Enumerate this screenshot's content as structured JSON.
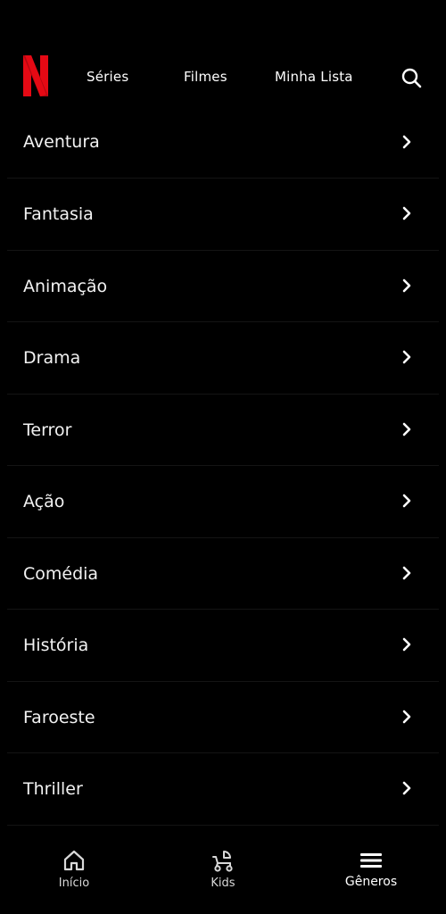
{
  "header": {
    "logo_letter": "N",
    "nav": {
      "series": "Séries",
      "filmes": "Filmes",
      "lista": "Minha Lista"
    },
    "search_icon": "search-icon"
  },
  "colors": {
    "background": "#000000",
    "brand_red": "#E50914",
    "text": "#FFFFFF",
    "divider": "#141414"
  },
  "genres": [
    {
      "label": "Aventura"
    },
    {
      "label": "Fantasia"
    },
    {
      "label": "Animação"
    },
    {
      "label": "Drama"
    },
    {
      "label": "Terror"
    },
    {
      "label": "Ação"
    },
    {
      "label": "Comédia"
    },
    {
      "label": "História"
    },
    {
      "label": "Faroeste"
    },
    {
      "label": "Thriller"
    }
  ],
  "bottom_nav": {
    "items": [
      {
        "label": "Início",
        "icon": "home-icon"
      },
      {
        "label": "Kids",
        "icon": "stroller-icon"
      },
      {
        "label": "Gêneros",
        "icon": "menu-icon",
        "active": true
      }
    ]
  }
}
